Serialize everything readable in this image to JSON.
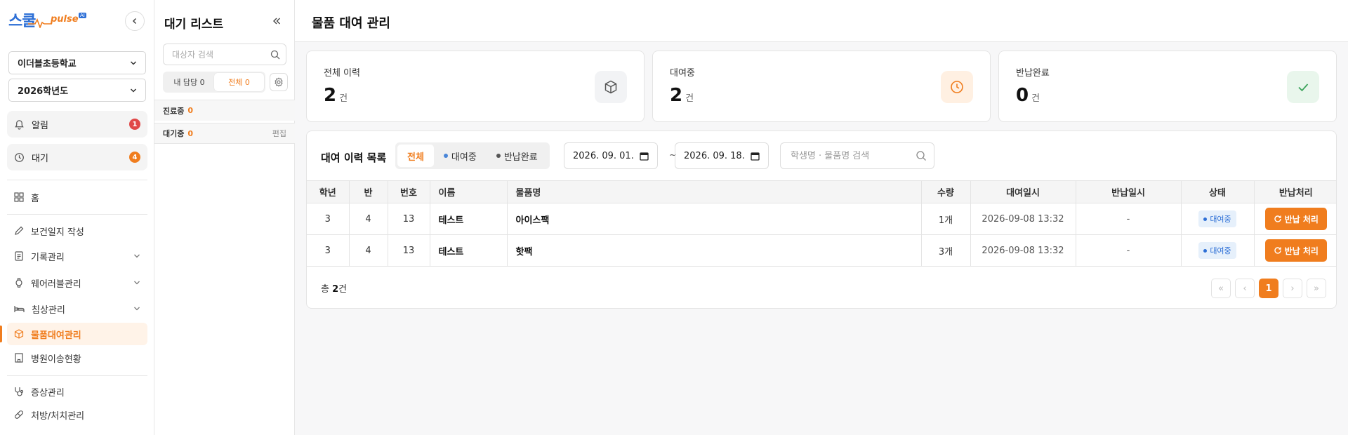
{
  "nav": {
    "logo_ko": "스쿨",
    "logo_en": "pulse",
    "logo_ai": "AI",
    "school": "이더블초등학교",
    "year": "2026학년도",
    "alerts": {
      "label": "알림",
      "count": "1"
    },
    "waiting": {
      "label": "대기",
      "count": "4"
    },
    "items": {
      "home": "홈",
      "health_log": "보건일지 작성",
      "records": "기록관리",
      "wearable": "웨어러블관리",
      "bed": "침상관리",
      "rental": "물품대여관리",
      "hospital": "병원이송현황",
      "symptom": "증상관리",
      "prescription": "처방/처치관리"
    },
    "colors": {
      "accent": "#f07d1e",
      "brand_blue": "#2d6fd6"
    }
  },
  "waitlist": {
    "title": "대기 리스트",
    "search_placeholder": "대상자 검색",
    "tab_mine": "내 담당 0",
    "tab_all": "전체 0",
    "in_treatment": {
      "label": "진료중",
      "count": "0"
    },
    "waiting": {
      "label": "대기중",
      "count": "0"
    },
    "edit": "편집"
  },
  "main": {
    "title": "물품 대여 관리",
    "cards": [
      {
        "title": "전체 이력",
        "value": "2",
        "unit": "건",
        "icon": "box-icon"
      },
      {
        "title": "대여중",
        "value": "2",
        "unit": "건",
        "icon": "clock-icon"
      },
      {
        "title": "반납완료",
        "value": "0",
        "unit": "건",
        "icon": "check-icon"
      }
    ],
    "list": {
      "title": "대여 이력 목록",
      "filters": {
        "all": "전체",
        "renting": "대여중",
        "returned": "반납완료"
      },
      "date_from": "2026. 09. 01.",
      "date_sep": "~",
      "date_to": "2026. 09. 18.",
      "search_placeholder": "학생명 · 물품명 검색",
      "columns": {
        "grade": "학년",
        "class": "반",
        "number": "번호",
        "name": "이름",
        "item": "물품명",
        "qty": "수량",
        "rented_at": "대여일시",
        "returned_at": "반납일시",
        "status": "상태",
        "action": "반납처리"
      },
      "rows": [
        {
          "grade": "3",
          "class": "4",
          "number": "13",
          "name": "테스트",
          "item": "아이스팩",
          "qty": "1개",
          "rented_at": "2026-09-08 13:32",
          "returned_at": "-",
          "status": "대여중",
          "action": "반납 처리"
        },
        {
          "grade": "3",
          "class": "4",
          "number": "13",
          "name": "테스트",
          "item": "핫팩",
          "qty": "3개",
          "rented_at": "2026-09-08 13:32",
          "returned_at": "-",
          "status": "대여중",
          "action": "반납 처리"
        }
      ],
      "total_prefix": "총",
      "total_count": "2",
      "total_suffix": "건",
      "pager": {
        "first": "«",
        "prev": "‹",
        "current": "1",
        "next": "›",
        "last": "»"
      }
    }
  }
}
